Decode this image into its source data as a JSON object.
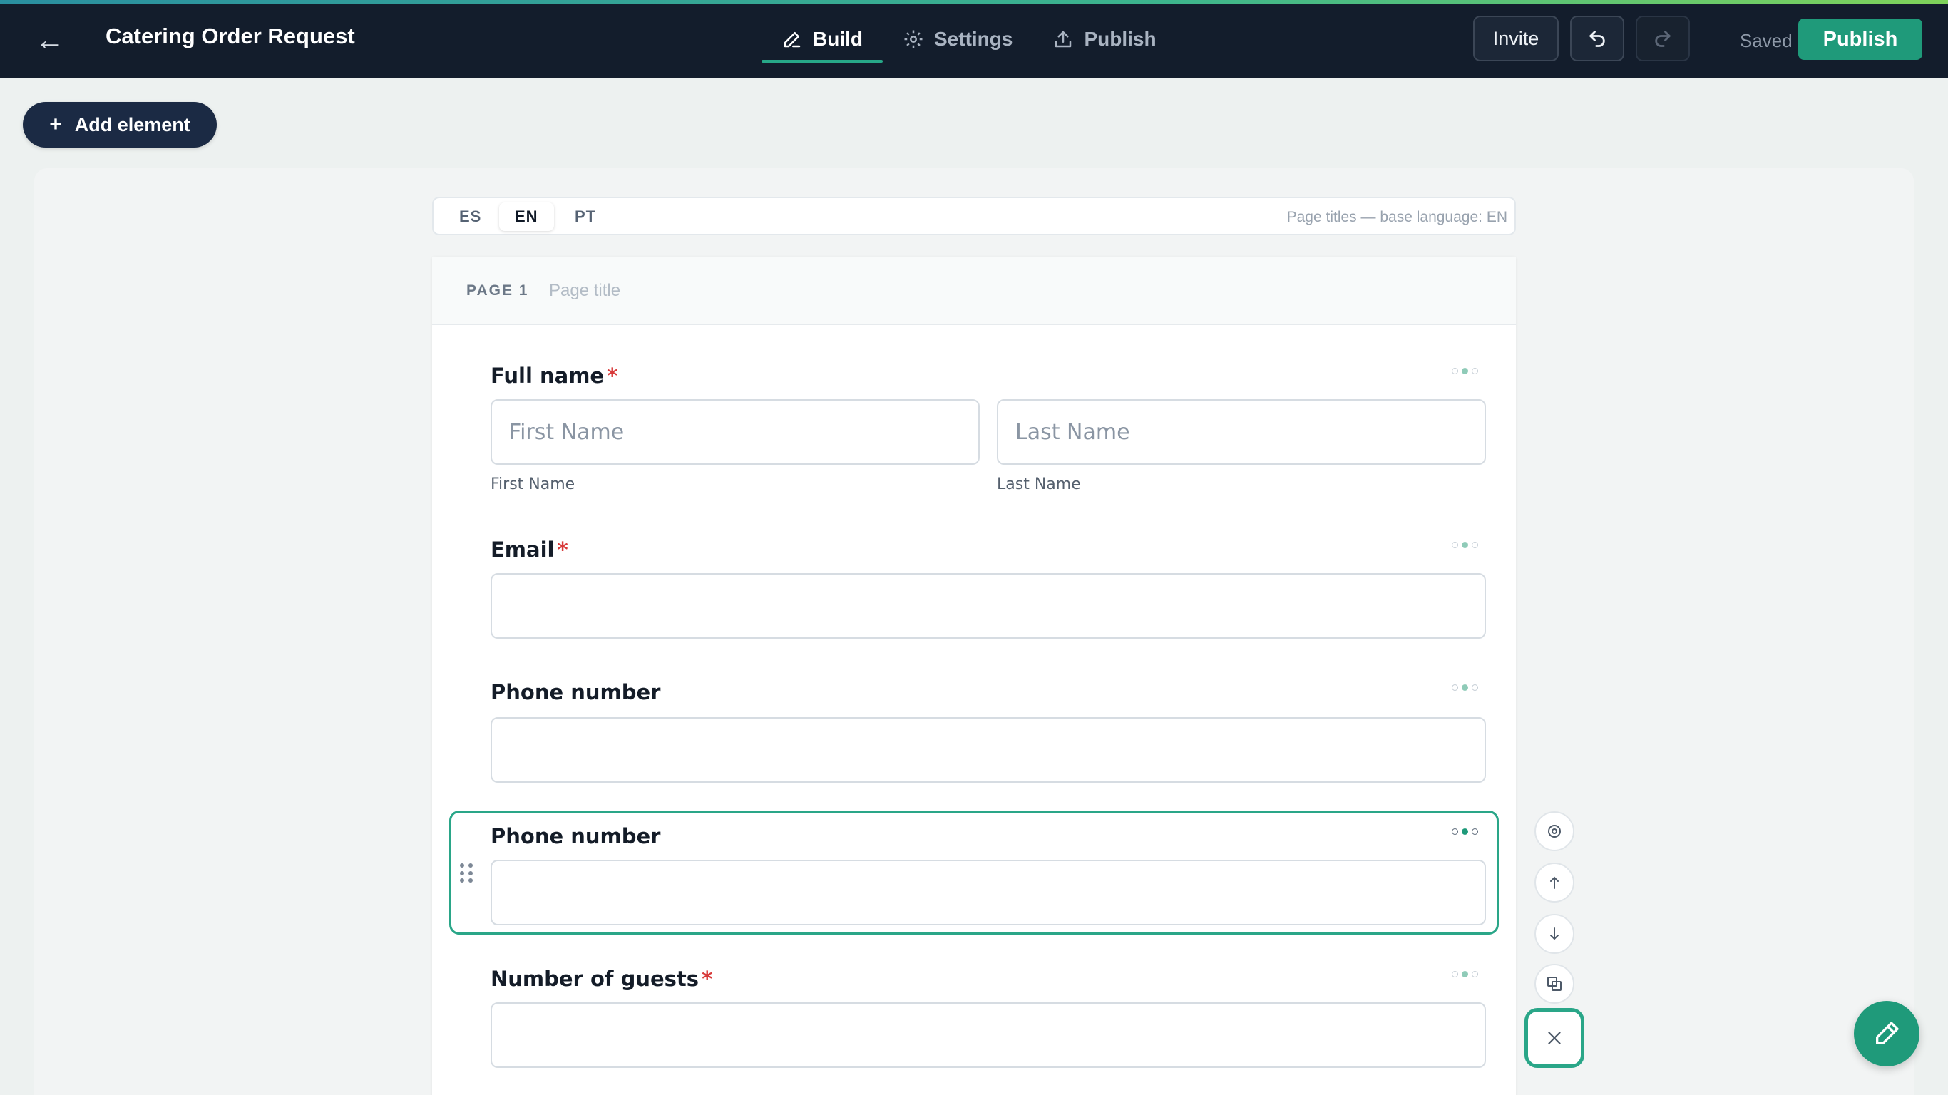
{
  "header": {
    "back_icon": "arrow-left-icon",
    "title": "Catering Order Request",
    "tabs": [
      {
        "label": "Build",
        "icon": "pencil-icon",
        "active": true
      },
      {
        "label": "Settings",
        "icon": "gear-icon",
        "active": false
      },
      {
        "label": "Publish",
        "icon": "upload-icon",
        "active": false
      }
    ],
    "invite_label": "Invite",
    "undo_icon": "undo-icon",
    "redo_icon": "redo-icon",
    "saved_label": "Saved",
    "publish_label": "Publish",
    "accent_color": "#1f9a7a",
    "bar_color": "#131d2c"
  },
  "toolbar": {
    "add_element_label": "Add element",
    "add_element_icon": "plus-icon"
  },
  "languages": {
    "tabs": [
      "ES",
      "EN",
      "PT"
    ],
    "active": "EN",
    "note": "Page titles — base language: EN"
  },
  "page": {
    "label": "PAGE 1",
    "title_placeholder": "Page title",
    "title_value": ""
  },
  "fields": [
    {
      "label": "Full name",
      "required": true,
      "first_placeholder": "First Name",
      "first_sublabel": "First Name",
      "last_placeholder": "Last Name",
      "last_sublabel": "Last Name"
    },
    {
      "label": "Email",
      "required": true,
      "value": ""
    },
    {
      "label": "Phone number",
      "required": false,
      "value": ""
    },
    {
      "label": "Phone number",
      "required": false,
      "value": "",
      "selected": true
    },
    {
      "label": "Number of guests",
      "required": true,
      "value": ""
    }
  ],
  "required_mark": "*",
  "side_tools": [
    "settings-icon",
    "move-up-icon",
    "move-down-icon",
    "duplicate-icon",
    "delete-icon"
  ],
  "fab_icon": "pencil-icon"
}
